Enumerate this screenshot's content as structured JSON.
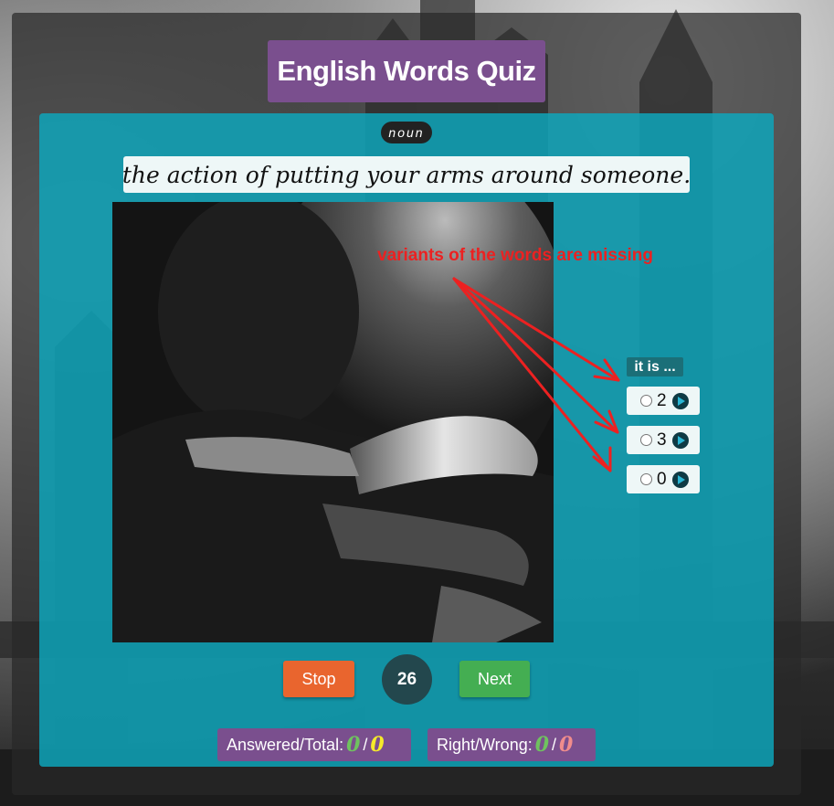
{
  "quiz": {
    "title": "English Words Quiz",
    "part_of_speech": "noun",
    "definition": "the action of putting your arms around someone.",
    "annotation": "variants of the words are missing",
    "options_header": "it is ...",
    "options": [
      {
        "label": "2"
      },
      {
        "label": "3"
      },
      {
        "label": "0"
      }
    ],
    "stop_label": "Stop",
    "next_label": "Next",
    "timer": "26",
    "stats": {
      "answered_total_label": "Answered/Total:",
      "answered": "0",
      "total": "0",
      "right_wrong_label": "Right/Wrong:",
      "right": "0",
      "wrong": "0",
      "separator": "/"
    }
  },
  "colors": {
    "title_bg": "#7a4f8e",
    "card_bg": "#0ca8be",
    "stop": "#e9652e",
    "next": "#44ae52",
    "annotation": "#ec2121"
  }
}
